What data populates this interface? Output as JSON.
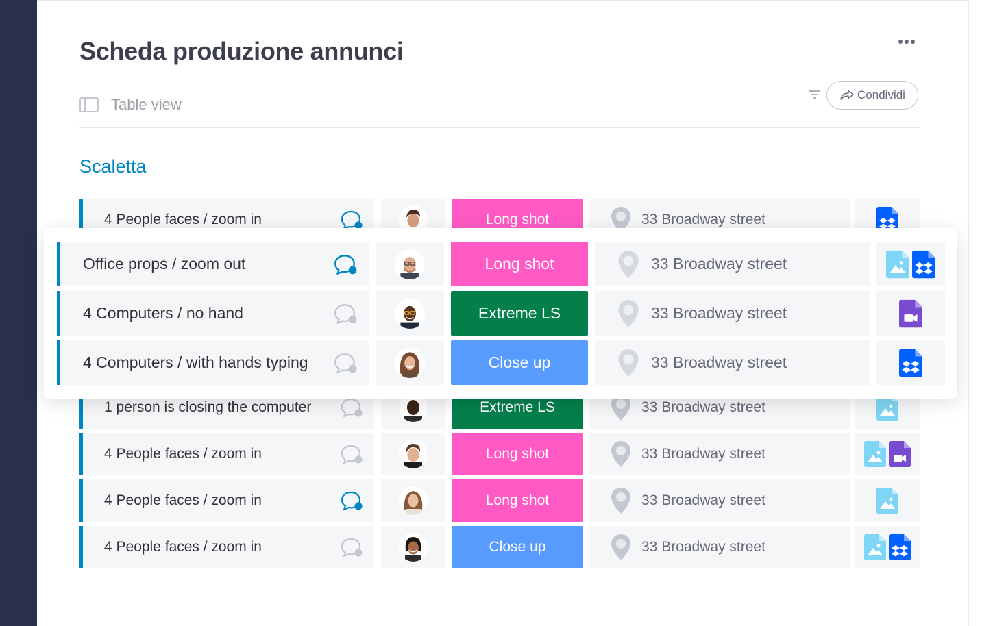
{
  "board": {
    "title": "Scheda produzione annunci",
    "view_tab": "Table view",
    "share_label": "Condividi"
  },
  "group": {
    "title": "Scaletta",
    "accent": "#0086c0"
  },
  "colors": {
    "long_shot": "#ff5ac4",
    "extreme_ls": "#037f4c",
    "close_up": "#579bfc",
    "chat_active": "#0086c0",
    "chat_inactive": "#c5c7d0"
  },
  "rows_background": [
    {
      "name": "4 People faces / zoom in",
      "chat_active": true,
      "status": "Long shot",
      "status_color": "#ff5ac4",
      "location": "33 Broadway street",
      "files": [
        "dropbox-file-icon"
      ]
    },
    {
      "name": "1 person is closing the computer",
      "chat_active": false,
      "status": "Extreme LS",
      "status_color": "#037f4c",
      "location": "33 Broadway street",
      "files": [
        "image-file-icon"
      ]
    },
    {
      "name": "4 People faces / zoom in",
      "chat_active": false,
      "status": "Long shot",
      "status_color": "#ff5ac4",
      "location": "33 Broadway street",
      "files": [
        "image-file-icon",
        "video-file-icon"
      ]
    },
    {
      "name": "4 People faces / zoom in",
      "chat_active": true,
      "status": "Long shot",
      "status_color": "#ff5ac4",
      "location": "33 Broadway street",
      "files": [
        "image-file-icon"
      ]
    },
    {
      "name": "4 People faces / zoom in",
      "chat_active": false,
      "status": "Close up",
      "status_color": "#579bfc",
      "location": "33 Broadway street",
      "files": [
        "image-file-icon",
        "dropbox-file-icon"
      ]
    }
  ],
  "rows_focused": [
    {
      "name": "Office props / zoom out",
      "chat_active": true,
      "status": "Long shot",
      "status_color": "#ff5ac4",
      "location": "33 Broadway street",
      "files": [
        "image-file-icon",
        "dropbox-file-icon"
      ]
    },
    {
      "name": "4 Computers / no hand",
      "chat_active": false,
      "status": "Extreme LS",
      "status_color": "#037f4c",
      "location": "33 Broadway street",
      "files": [
        "video-file-icon"
      ]
    },
    {
      "name": "4 Computers / with hands typing",
      "chat_active": false,
      "status": "Close up",
      "status_color": "#579bfc",
      "location": "33 Broadway street",
      "files": [
        "dropbox-file-icon"
      ]
    }
  ]
}
